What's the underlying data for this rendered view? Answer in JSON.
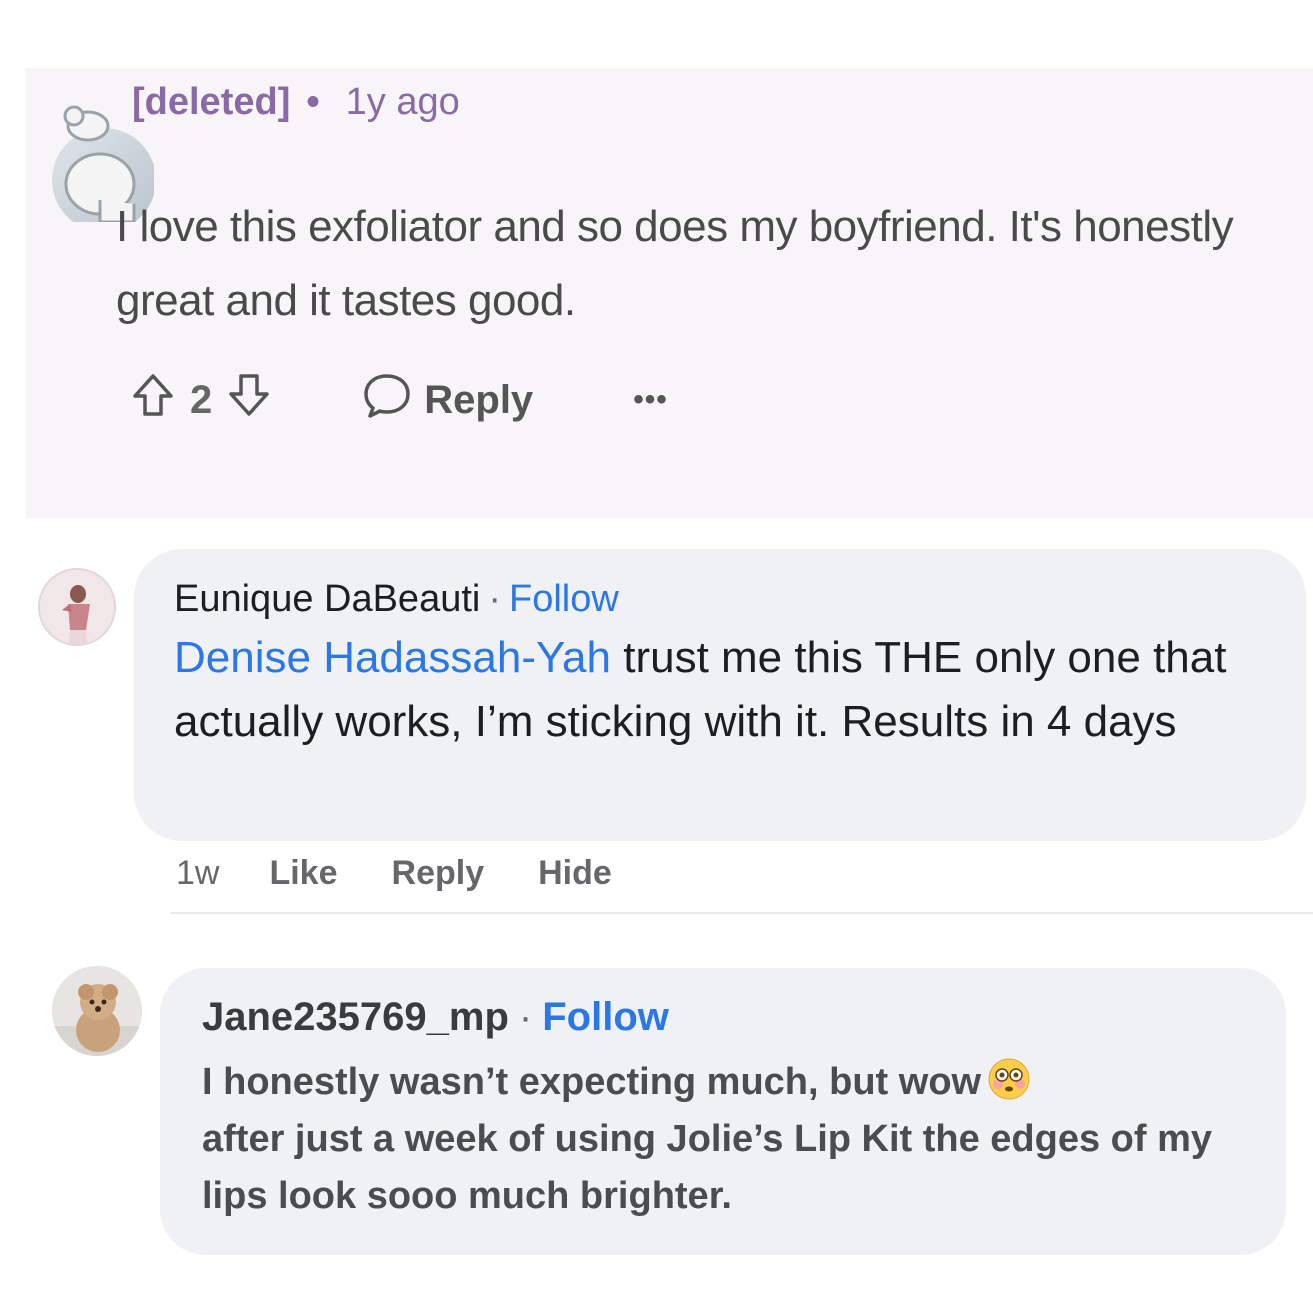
{
  "reddit_comment": {
    "username": "[deleted]",
    "separator": "•",
    "time": "1y ago",
    "body": "I love this exfoliator and so does my boyfriend. It's honestly great and it tastes good.",
    "vote_count": "2",
    "reply_label": "Reply",
    "more_label": "•••"
  },
  "facebook_comments": [
    {
      "author": "Eunique DaBeauti",
      "separator": "·",
      "follow_label": "Follow",
      "mention": "Denise Hadassah-Yah",
      "body": " trust me this THE only one that actually works, I’m sticking with it. Results in 4 days",
      "time": "1w",
      "actions": [
        "Like",
        "Reply",
        "Hide"
      ]
    },
    {
      "author": "Jane235769_mp",
      "separator": "·",
      "follow_label": "Follow",
      "body_before_emoji": "I honestly wasn’t expecting much, but wow",
      "emoji": "flushed-face-emoji",
      "body_after_emoji": "after just a week of using Jolie’s Lip Kit the edges of my lips look sooo much brighter."
    }
  ],
  "colors": {
    "reddit_accent": "#8a6aa6",
    "fb_link": "#2b78e4",
    "bubble": "#f0f1f5"
  }
}
